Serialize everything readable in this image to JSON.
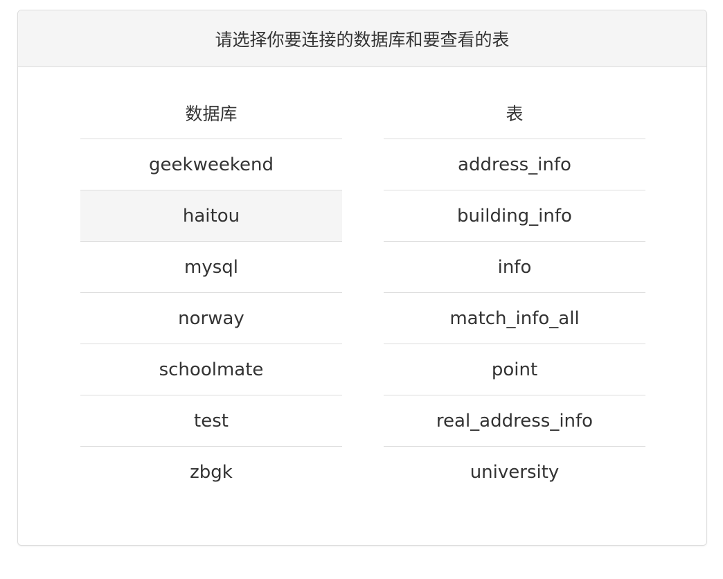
{
  "panel": {
    "title": "请选择你要连接的数据库和要查看的表"
  },
  "databases": {
    "header": "数据库",
    "items": [
      "geekweekend",
      "haitou",
      "mysql",
      "norway",
      "schoolmate",
      "test",
      "zbgk"
    ],
    "selected": "haitou"
  },
  "tables": {
    "header": "表",
    "items": [
      "address_info",
      "building_info",
      "info",
      "match_info_all",
      "point",
      "real_address_info",
      "university"
    ]
  }
}
